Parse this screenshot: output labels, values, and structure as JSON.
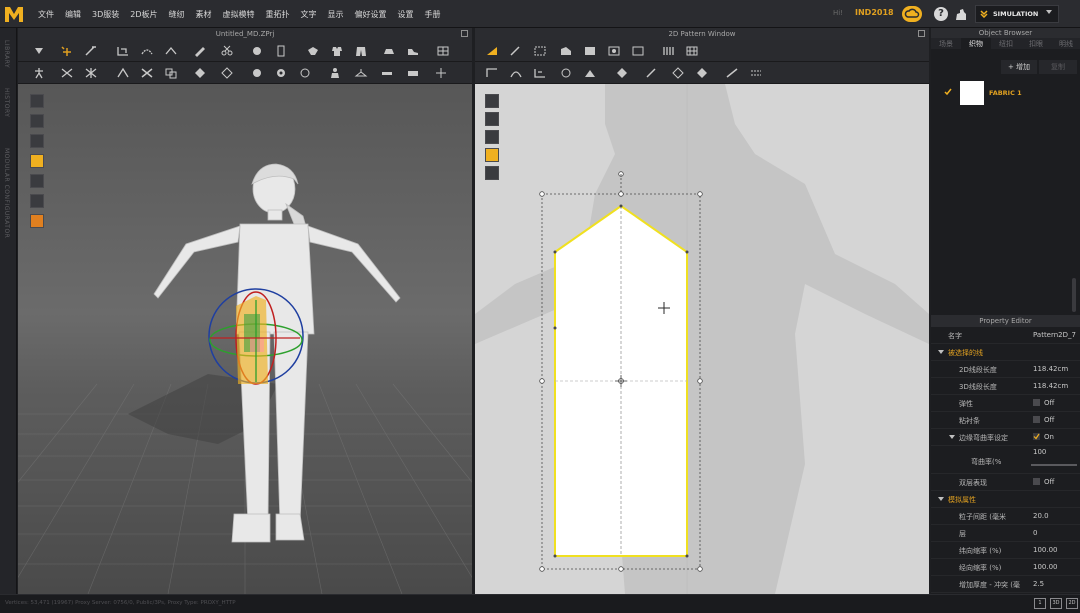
{
  "app": {
    "logo": "MD"
  },
  "menu": {
    "items": [
      "文件",
      "编辑",
      "3D服装",
      "2D板片",
      "缝纫",
      "素材",
      "虚拟模特",
      "重拓扑",
      "文字",
      "显示",
      "偏好设置",
      "设置",
      "手册"
    ]
  },
  "user": {
    "label": "Hi!",
    "name": "IND2018"
  },
  "mode": {
    "label": "SIMULATION"
  },
  "side_tabs": [
    "LIBRARY",
    "HISTORY",
    "MODULAR CONFIGURATOR"
  ],
  "window3d": {
    "title": "Untitled_MD.ZPrj"
  },
  "window2d": {
    "title": "2D Pattern Window"
  },
  "object_browser": {
    "title": "Object Browser",
    "tabs": [
      "场景",
      "织物",
      "纽扣",
      "扣眼",
      "明线"
    ],
    "active_tab": 1,
    "add_label": "+ 增加",
    "copy_label": "复制",
    "fabric": {
      "name": "FABRIC 1",
      "color": "#ffffff"
    }
  },
  "property_editor": {
    "title": "Property Editor",
    "name_label": "名字",
    "name_value": "Pattern2D_7",
    "section1": "被选择的线",
    "len2d_label": "2D线段长度",
    "len2d_value": "118.42cm",
    "len3d_label": "3D线段长度",
    "len3d_value": "118.42cm",
    "elastic_label": "弹性",
    "elastic_value": "Off",
    "lining_label": "粘衬条",
    "lining_value": "Off",
    "curvature_label": "边缘弯曲率设定",
    "curvature_value": "On",
    "curve_rate_label": "弯曲率(%",
    "curve_rate_value": "100",
    "double_label": "双层表现",
    "double_value": "Off",
    "section2": "模拟属性",
    "particle_label": "粒子间距 (毫米",
    "particle_value": "20.0",
    "layer_label": "层",
    "layer_value": "0",
    "warp_label": "纬向缩率 (%)",
    "warp_value": "100.00",
    "weft_label": "经向缩率 (%)",
    "weft_value": "100.00",
    "extra_label": "增加厚度 - 冲突 (毫",
    "extra_value": "2.5"
  },
  "status": {
    "text": "Vertices: 53,471 (19967)    Proxy Server: 0756/0, Public/3Ps, Proxy Type: PROXY_HTTP",
    "buttons": [
      "1",
      "3D",
      "2D"
    ]
  },
  "colors": {
    "accent": "#e0a020",
    "selection_yellow": "#f0e020",
    "panel_bg": "#1c1d20"
  }
}
